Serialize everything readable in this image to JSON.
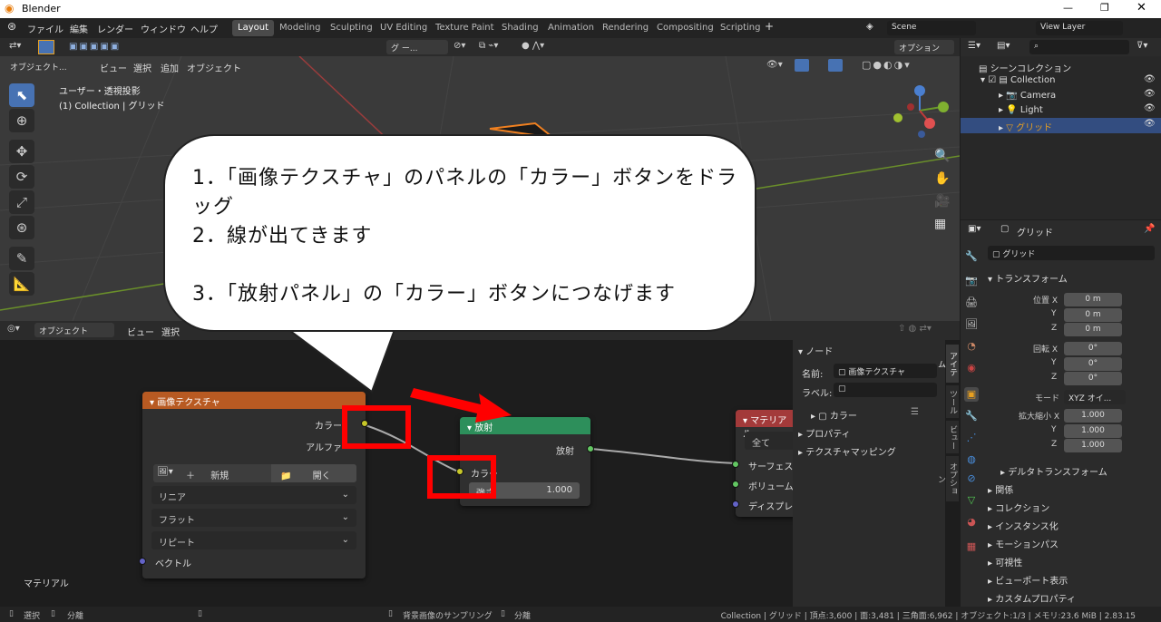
{
  "app_title": "Blender",
  "menu": [
    "ファイル",
    "編集",
    "レンダー",
    "ウィンドウ",
    "ヘルプ"
  ],
  "workspaces": [
    "Layout",
    "Modeling",
    "Sculpting",
    "UV Editing",
    "Texture Paint",
    "Shading",
    "Animation",
    "Rendering",
    "Compositing",
    "Scripting"
  ],
  "scene": "Scene",
  "view_layer": "View Layer",
  "viewport": {
    "mode": "オブジェクト...",
    "menus": [
      "ビュー",
      "選択",
      "追加",
      "オブジェクト"
    ],
    "view_name": "ユーザー・透視投影",
    "collection_info": "(1) Collection | グリッド",
    "options": "オプション",
    "transform_dropdown": "グ ー..."
  },
  "node_editor": {
    "mode": "オブジェクト",
    "menus": [
      "ビュー",
      "選択"
    ],
    "corner_label": "マテリアル"
  },
  "image_node": {
    "title": "画像テクスチャ",
    "out_color": "カラー",
    "out_alpha": "アルファ",
    "new": "新規",
    "open": "開く",
    "interp": "リニア",
    "proj": "フラット",
    "ext": "リピート",
    "vector": "ベクトル"
  },
  "emission_node": {
    "title": "放射",
    "output": "放射",
    "color": "カラー",
    "strength_label": "強さ",
    "strength": "1.000"
  },
  "material_node": {
    "title": "マテリアル...",
    "target": "全て",
    "inputs": [
      "サーフェス",
      "ボリューム",
      "ディスプレ..."
    ]
  },
  "node_panel": {
    "header": "ノード",
    "name_label": "名前:",
    "name_value": "画像テクスチャ",
    "label_label": "ラベル:",
    "color": "カラー",
    "properties": "プロパティ",
    "mapping": "テクスチャマッピング",
    "tabs": [
      "アイテム",
      "ツール",
      "ビュー",
      "オプション"
    ]
  },
  "outliner": {
    "root": "シーンコレクション",
    "items": [
      "Collection",
      "Camera",
      "Light",
      "グリッド"
    ]
  },
  "properties": {
    "object_name": "グリッド",
    "transform": "トランスフォーム",
    "loc_label": "位置 X",
    "rot_label": "回転 X",
    "scale_label": "拡大縮小 X",
    "y": "Y",
    "z": "Z",
    "loc": [
      "0 m",
      "0 m",
      "0 m"
    ],
    "rot": [
      "0°",
      "0°",
      "0°"
    ],
    "mode_label": "モード",
    "mode": "XYZ オイ...",
    "scale": [
      "1.000",
      "1.000",
      "1.000"
    ],
    "delta": "デルタトランスフォーム",
    "sections": [
      "関係",
      "コレクション",
      "インスタンス化",
      "モーションパス",
      "可視性",
      "ビューポート表示",
      "カスタムプロパティ"
    ]
  },
  "status": {
    "select": "選択",
    "split": "分離",
    "sampling": "背景画像のサンプリング",
    "split2": "分離",
    "stats": "Collection | グリッド | 頂点:3,600 | 面:3,481 | 三角面:6,962 | オブジェクト:1/3 | メモリ:23.6 MiB | 2.83.15"
  },
  "callout": {
    "line1": "1．「画像テクスチャ」のパネルの「カラー」ボタンをドラッグ",
    "line2": "2．線が出てきます",
    "line3": "3．「放射パネル」の「カラー」ボタンにつなげます"
  },
  "colors": {
    "accent": "#4772b3",
    "image_header": "#b85a22",
    "emission_header": "#2d8f5b",
    "material_header": "#a33a3a",
    "socket_yellow": "#c7c729",
    "socket_green": "#63c763",
    "socket_blue": "#6363c7",
    "callout_red": "#ff0000"
  }
}
